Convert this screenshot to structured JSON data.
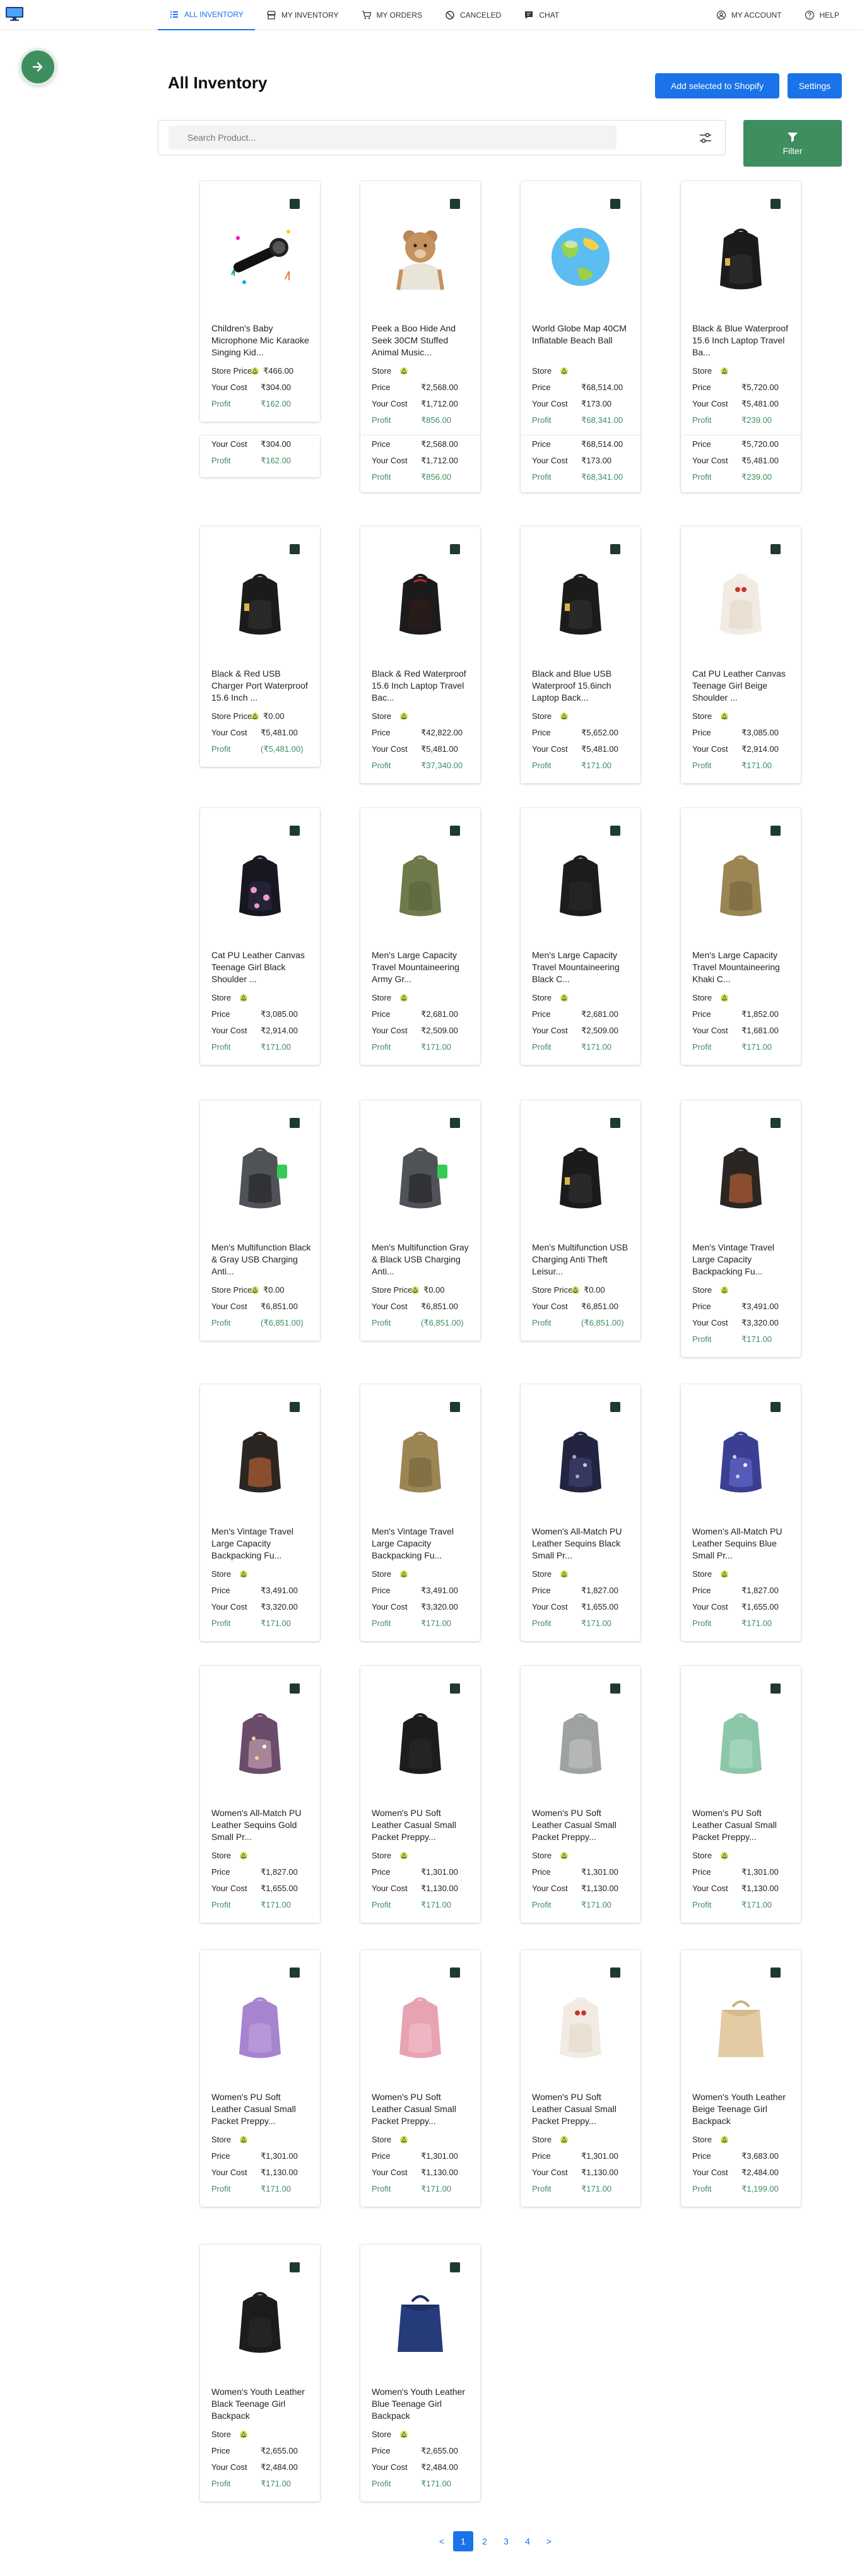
{
  "nav": {
    "items": [
      {
        "label": "ALL INVENTORY",
        "icon": "list-icon",
        "active": true
      },
      {
        "label": "MY INVENTORY",
        "icon": "store-icon",
        "active": false
      },
      {
        "label": "MY ORDERS",
        "icon": "cart-icon",
        "active": false
      },
      {
        "label": "CANCELED",
        "icon": "cancel-icon",
        "active": false
      },
      {
        "label": "CHAT",
        "icon": "chat-icon",
        "active": false
      }
    ],
    "right": [
      {
        "label": "MY ACCOUNT",
        "icon": "account-icon"
      },
      {
        "label": "HELP",
        "icon": "help-icon"
      }
    ]
  },
  "header": {
    "title": "All Inventory",
    "shopify_label": "Add selected to Shopify",
    "settings_label": "Settings"
  },
  "search": {
    "placeholder": "Search Product..."
  },
  "filter": {
    "label": "Filter"
  },
  "labels": {
    "store": "Store",
    "price": "Price",
    "store_price": "Store Price",
    "cost": "Your Cost",
    "profit": "Profit"
  },
  "products": [
    {
      "title": "Children's Baby Microphone Mic Karaoke Singing Kid...",
      "store_price": "₹466.00",
      "price": null,
      "cost": "₹304.00",
      "profit": "₹162.00",
      "kind": "mic"
    },
    {
      "title": "Peek a Boo Hide And Seek 30CM Stuffed Animal Music...",
      "price": "₹2,568.00",
      "cost": "₹1,712.00",
      "profit": "₹856.00",
      "kind": "bear"
    },
    {
      "title": "World Globe Map 40CM Inflatable Beach Ball",
      "price": "₹68,514.00",
      "cost": "₹173.00",
      "profit": "₹68,341.00",
      "kind": "globe"
    },
    {
      "title": "Black & Blue Waterproof 15.6 Inch Laptop Travel Ba...",
      "price": "₹5,720.00",
      "cost": "₹5,481.00",
      "profit": "₹239.00",
      "kind": "bp-black"
    },
    {
      "title": "Black & Red USB Charger Port Waterproof 15.6 Inch ...",
      "store_price": "₹0.00",
      "cost": "₹5,481.00",
      "profit": "(₹5,481.00)",
      "kind": "bp-black"
    },
    {
      "title": "Black & Red Waterproof 15.6 Inch Laptop Travel Bac...",
      "price": "₹42,822.00",
      "cost": "₹5,481.00",
      "profit": "₹37,340.00",
      "kind": "bp-red"
    },
    {
      "title": "Black and Blue USB Waterproof 15.6inch Laptop Back...",
      "price": "₹5,652.00",
      "cost": "₹5,481.00",
      "profit": "₹171.00",
      "kind": "bp-black"
    },
    {
      "title": "Cat PU Leather Canvas Teenage Girl Beige Shoulder ...",
      "price": "₹3,085.00",
      "cost": "₹2,914.00",
      "profit": "₹171.00",
      "kind": "bp-white"
    },
    {
      "title": "Cat PU Leather Canvas Teenage Girl Black Shoulder ...",
      "price": "₹3,085.00",
      "cost": "₹2,914.00",
      "profit": "₹171.00",
      "kind": "bp-cat"
    },
    {
      "title": "Men's Large Capacity Travel Mountaineering Army Gr...",
      "price": "₹2,681.00",
      "cost": "₹2,509.00",
      "profit": "₹171.00",
      "kind": "bp-army"
    },
    {
      "title": "Men's Large Capacity Travel Mountaineering Black C...",
      "price": "₹2,681.00",
      "cost": "₹2,509.00",
      "profit": "₹171.00",
      "kind": "bp-dark"
    },
    {
      "title": "Men's Large Capacity Travel Mountaineering Khaki C...",
      "price": "₹1,852.00",
      "cost": "₹1,681.00",
      "profit": "₹171.00",
      "kind": "bp-khaki"
    },
    {
      "title": "Men's Multifunction Black & Gray USB Charging Anti...",
      "store_price": "₹0.00",
      "cost": "₹6,851.00",
      "profit": "(₹6,851.00)",
      "kind": "bp-gray"
    },
    {
      "title": "Men's Multifunction Gray & Black USB Charging Anti...",
      "store_price": "₹0.00",
      "cost": "₹6,851.00",
      "profit": "(₹6,851.00)",
      "kind": "bp-gray"
    },
    {
      "title": "Men's Multifunction USB Charging Anti Theft Leisur...",
      "store_price": "₹0.00",
      "cost": "₹6,851.00",
      "profit": "(₹6,851.00)",
      "kind": "bp-black"
    },
    {
      "title": "Men's Vintage Travel Large Capacity Backpacking Fu...",
      "price": "₹3,491.00",
      "cost": "₹3,320.00",
      "profit": "₹171.00",
      "kind": "bp-vintage"
    },
    {
      "title": "Men's Vintage Travel Large Capacity Backpacking Fu...",
      "price": "₹3,491.00",
      "cost": "₹3,320.00",
      "profit": "₹171.00",
      "kind": "bp-vintage"
    },
    {
      "title": "Men's Vintage Travel Large Capacity Backpacking Fu...",
      "price": "₹3,491.00",
      "cost": "₹3,320.00",
      "profit": "₹171.00",
      "kind": "bp-khaki"
    },
    {
      "title": "Women's All-Match PU Leather Sequins Black Small Pr...",
      "price": "₹1,827.00",
      "cost": "₹1,655.00",
      "profit": "₹171.00",
      "kind": "bp-sequin"
    },
    {
      "title": "Women's All-Match PU Leather Sequins Blue Small Pr...",
      "price": "₹1,827.00",
      "cost": "₹1,655.00",
      "profit": "₹171.00",
      "kind": "bp-blue-sequin"
    },
    {
      "title": "Women's All-Match PU Leather Sequins Gold Small Pr...",
      "price": "₹1,827.00",
      "cost": "₹1,655.00",
      "profit": "₹171.00",
      "kind": "bp-gold-sequin"
    },
    {
      "title": "Women's PU Soft Leather Casual Small Packet Preppy...",
      "price": "₹1,301.00",
      "cost": "₹1,130.00",
      "profit": "₹171.00",
      "kind": "bp-dark"
    },
    {
      "title": "Women's PU Soft Leather Casual Small Packet Preppy...",
      "price": "₹1,301.00",
      "cost": "₹1,130.00",
      "profit": "₹171.00",
      "kind": "bp-lightgray"
    },
    {
      "title": "Women's PU Soft Leather Casual Small Packet Preppy...",
      "price": "₹1,301.00",
      "cost": "₹1,130.00",
      "profit": "₹171.00",
      "kind": "bp-mint"
    },
    {
      "title": "Women's PU Soft Leather Casual Small Packet Preppy...",
      "price": "₹1,301.00",
      "cost": "₹1,130.00",
      "profit": "₹171.00",
      "kind": "bp-purple"
    },
    {
      "title": "Women's PU Soft Leather Casual Small Packet Preppy...",
      "price": "₹1,301.00",
      "cost": "₹1,130.00",
      "profit": "₹171.00",
      "kind": "bp-pink"
    },
    {
      "title": "Women's PU Soft Leather Casual Small Packet Preppy...",
      "price": "₹1,301.00",
      "cost": "₹1,130.00",
      "profit": "₹171.00",
      "kind": "bp-white"
    },
    {
      "title": "Women's Youth Leather Beige Teenage Girl Backpack",
      "price": "₹3,683.00",
      "cost": "₹2,484.00",
      "profit": "₹1,199.00",
      "kind": "bp-beige"
    },
    {
      "title": "Women's Youth Leather Black Teenage Girl Backpack",
      "price": "₹2,655.00",
      "cost": "₹2,484.00",
      "profit": "₹171.00",
      "kind": "bp-dark"
    },
    {
      "title": "Women's Youth Leather Blue Teenage Girl Backpack",
      "price": "₹2,655.00",
      "cost": "₹2,484.00",
      "profit": "₹171.00",
      "kind": "bp-navy"
    }
  ],
  "first_row_ghost": [
    {
      "cost": "₹304.00",
      "profit": "₹162.00"
    },
    {
      "price": "₹2,568.00",
      "cost": "₹1,712.00",
      "profit": "₹856.00"
    },
    {
      "price": "₹68,514.00",
      "cost": "₹173.00",
      "profit": "₹68,341.00"
    },
    {
      "price": "₹5,720.00",
      "cost": "₹5,481.00",
      "profit": "₹239.00"
    }
  ],
  "pagination": {
    "prev": "<",
    "pages": [
      "1",
      "2",
      "3",
      "4"
    ],
    "current": "1",
    "next": ">"
  },
  "colors": {
    "accent": "#1a73e8",
    "green": "#3e8e60",
    "dark_green": "#1f3b2d"
  }
}
